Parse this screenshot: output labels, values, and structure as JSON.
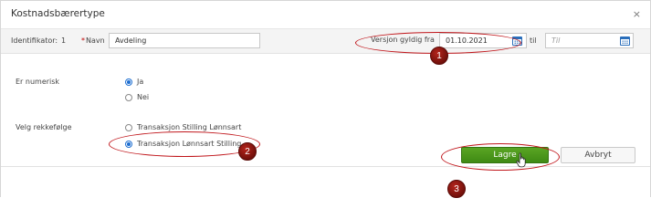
{
  "dialog": {
    "title": "Kostnadsbærertype",
    "close_glyph": "×"
  },
  "header_row": {
    "identifier_label": "Identifikator:",
    "identifier_value": "1",
    "name_required_mark": "*",
    "name_label": "Navn",
    "name_value": "Avdeling",
    "valid_from_label": "Versjon gyldig fra",
    "valid_from_value": "01.10.2021",
    "to_label": "til",
    "to_placeholder": "Til"
  },
  "form": {
    "numeric_label": "Er numerisk",
    "numeric_options": [
      {
        "label": "Ja",
        "checked": true
      },
      {
        "label": "Nei",
        "checked": false
      }
    ],
    "order_label": "Velg rekkefølge",
    "order_options": [
      {
        "label": "Transaksjon Stilling Lønnsart",
        "checked": false
      },
      {
        "label": "Transaksjon Lønnsart Stilling",
        "checked": true
      }
    ]
  },
  "footer": {
    "save_label": "Lagre",
    "cancel_label": "Avbryt"
  },
  "annotations": {
    "markers": [
      "1",
      "2",
      "3"
    ],
    "color": "#c0161b"
  }
}
